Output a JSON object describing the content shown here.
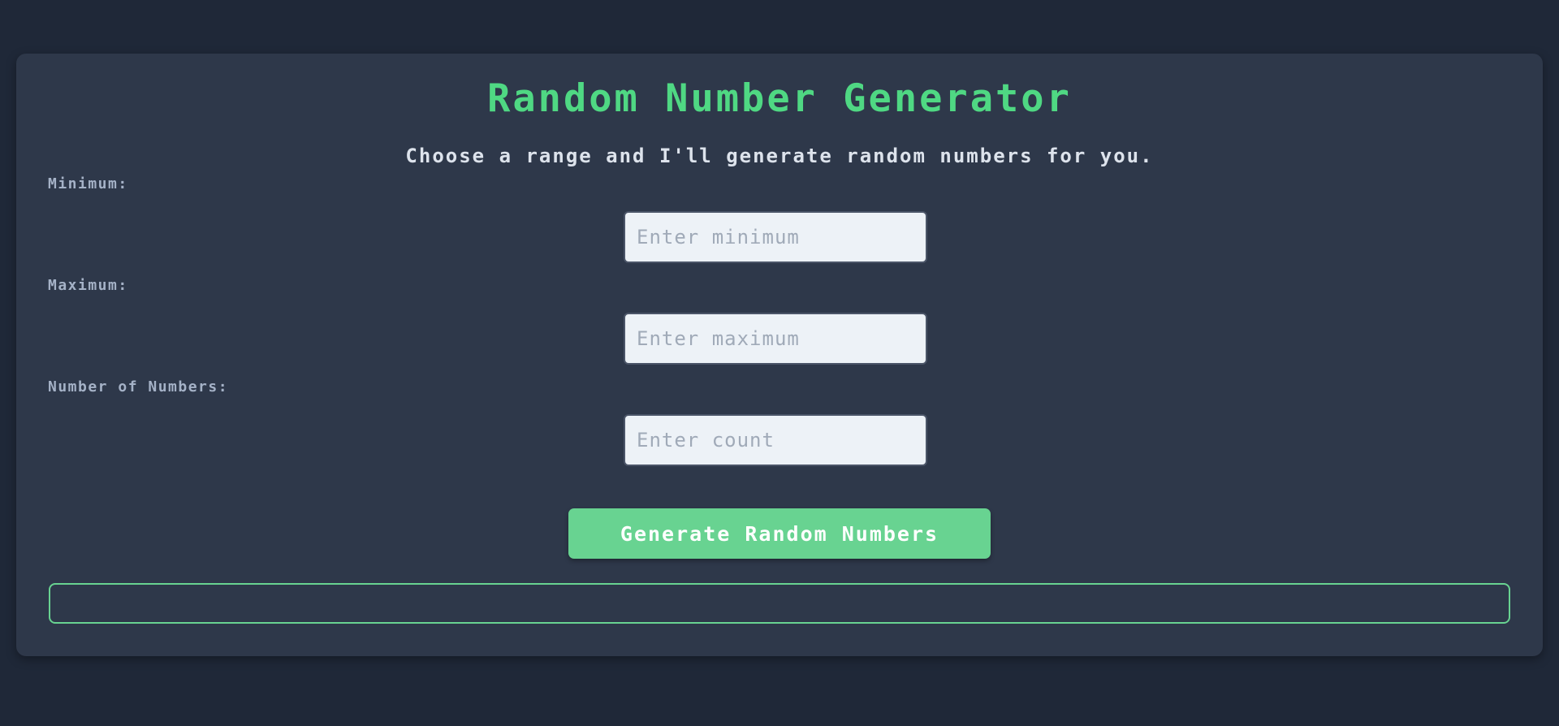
{
  "app": {
    "title": "Random Number Generator",
    "subtitle": "Choose a range and I'll generate random numbers for you."
  },
  "form": {
    "minimum": {
      "label": "Minimum:",
      "placeholder": "Enter minimum",
      "value": ""
    },
    "maximum": {
      "label": "Maximum:",
      "placeholder": "Enter maximum",
      "value": ""
    },
    "count": {
      "label": "Number of Numbers:",
      "placeholder": "Enter count",
      "value": ""
    },
    "generate_label": "Generate Random Numbers"
  },
  "result": {
    "text": ""
  },
  "colors": {
    "page_background": "#1f2838",
    "card_background": "#2e384a",
    "accent": "#4fd883",
    "button": "#68d391",
    "label": "#a5b2c7",
    "input_background": "#edf2f7"
  }
}
